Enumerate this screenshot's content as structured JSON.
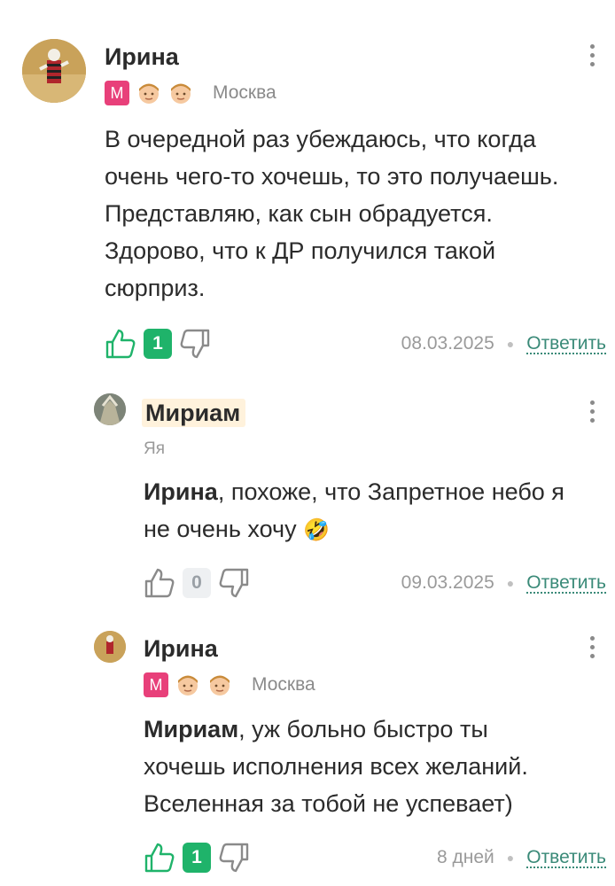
{
  "comments": [
    {
      "author": "Ирина",
      "badge_letter": "М",
      "city": "Москва",
      "text_lines": [
        "В очередной раз убеждаюсь, что когда",
        "очень чего-то хочешь, то это получаешь.",
        "Представляю, как сын обрадуется.",
        "Здорово, что к ДР получился такой",
        "сюрприз."
      ],
      "votes": "1",
      "date": "08.03.2025",
      "reply_label": "Ответить"
    },
    {
      "author": "Мириам",
      "subtitle": "Яя",
      "mention": "Ирина",
      "text_rest_1": ", похоже, что Запретное небо я",
      "text_line_2": "не очень хочу",
      "emoji": "🤣",
      "votes": "0",
      "date": "09.03.2025",
      "reply_label": "Ответить"
    },
    {
      "author": "Ирина",
      "badge_letter": "М",
      "city": "Москва",
      "mention": "Мириам",
      "text_rest_1": ", уж больно быстро ты",
      "text_line_2": "хочешь исполнения всех желаний.",
      "text_line_3": "Вселенная за тобой не успевает)",
      "votes": "1",
      "date": "8 дней",
      "reply_label": "Ответить"
    }
  ],
  "colors": {
    "accent_green": "#1fb36a",
    "reply_link": "#3a8a78",
    "badge_pink": "#e8407a",
    "name_highlight": "#fff2dc"
  },
  "icons": [
    "thumbs-up-icon",
    "thumbs-down-icon",
    "more-vertical-icon",
    "face-badge-icon"
  ]
}
